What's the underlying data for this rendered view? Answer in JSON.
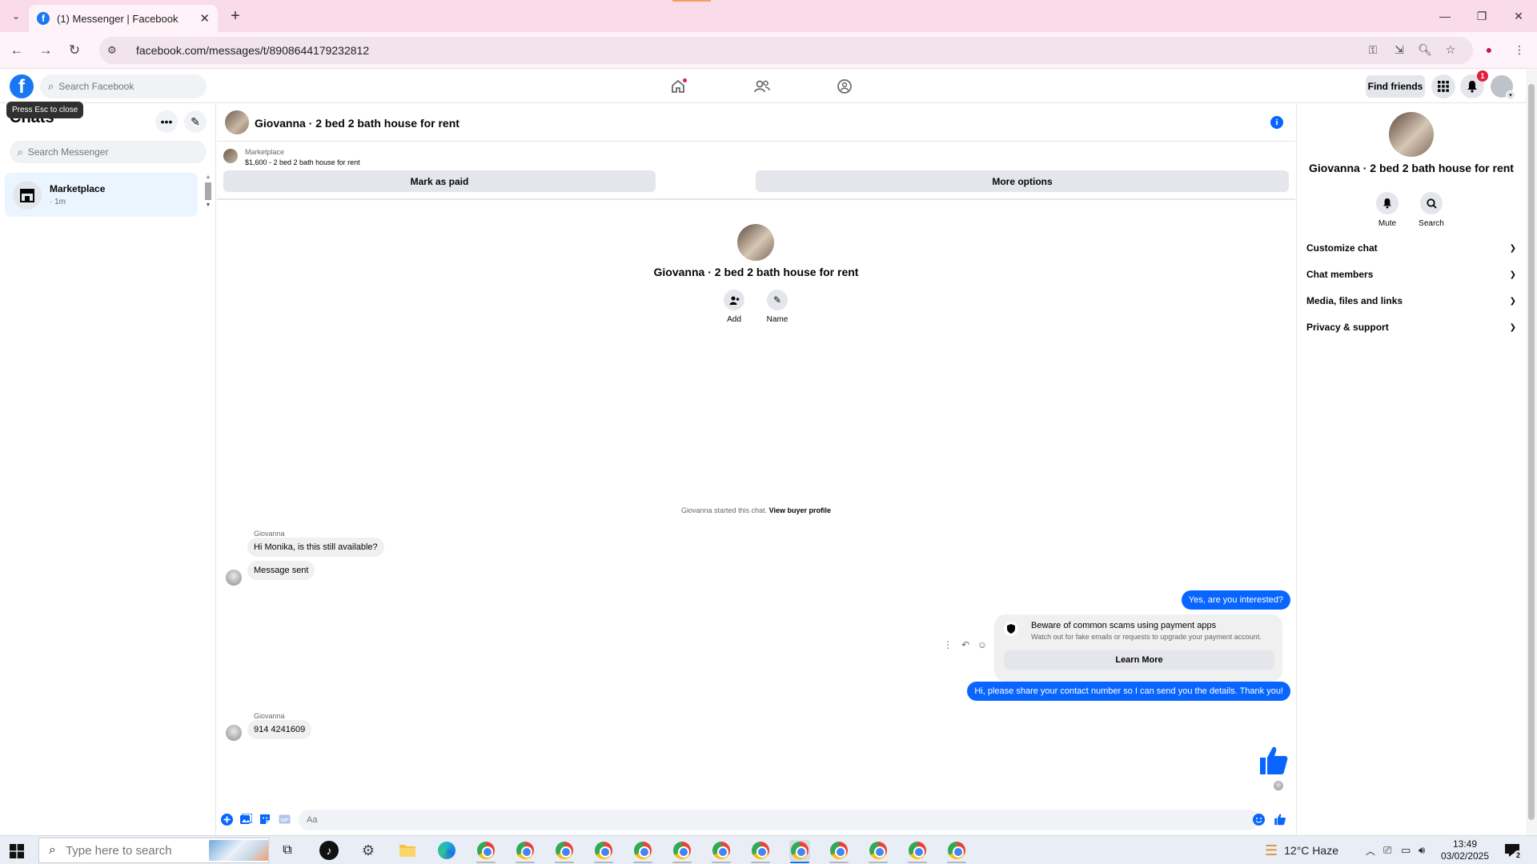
{
  "browser": {
    "tab_title": "(1) Messenger | Facebook",
    "url": "facebook.com/messages/t/8908644179232812"
  },
  "fb_header": {
    "search_placeholder": "Search Facebook",
    "find_friends": "Find friends",
    "notification_count": "1"
  },
  "left": {
    "title": "Chats",
    "tooltip": "Press Esc to close",
    "search_placeholder": "Search Messenger",
    "chats": [
      {
        "name": "Marketplace",
        "time": "· 1m"
      }
    ]
  },
  "conversation": {
    "title": "Giovanna · 2 bed 2 bath house for rent",
    "marketplace_label": "Marketplace",
    "listing": "$1,600 - 2 bed 2 bath house for rent",
    "mark_paid": "Mark as paid",
    "more_options": "More options",
    "center_name": "Giovanna · 2 bed 2 bath house for rent",
    "actions": {
      "add": "Add",
      "name": "Name"
    },
    "system_note": "Giovanna started this chat.",
    "view_buyer": "View buyer profile",
    "messages": {
      "sender": "Giovanna",
      "m1": "Hi Monika, is this still available?",
      "m2": "Message sent",
      "out1": "Yes, are you interested?",
      "out2": "Hi, please share your contact number so I can send you the details. Thank you!",
      "m3": "914 4241609"
    },
    "scam_notice": {
      "title": "Beware of common scams using payment apps",
      "body": "Watch out for fake emails or requests to upgrade your payment account.",
      "button": "Learn More"
    },
    "composer_placeholder": "Aa"
  },
  "right": {
    "name": "Giovanna · 2 bed 2 bath house for rent",
    "mute": "Mute",
    "search": "Search",
    "sections": [
      "Customize chat",
      "Chat members",
      "Media, files and links",
      "Privacy & support"
    ]
  },
  "taskbar": {
    "search_placeholder": "Type here to search",
    "weather": "12°C  Haze",
    "time": "13:49",
    "date": "03/02/2025",
    "notif_count": "2"
  },
  "colors": {
    "accent": "#0866ff",
    "fb_blue": "#1877f2",
    "bubble_in": "#f0f0f0"
  }
}
